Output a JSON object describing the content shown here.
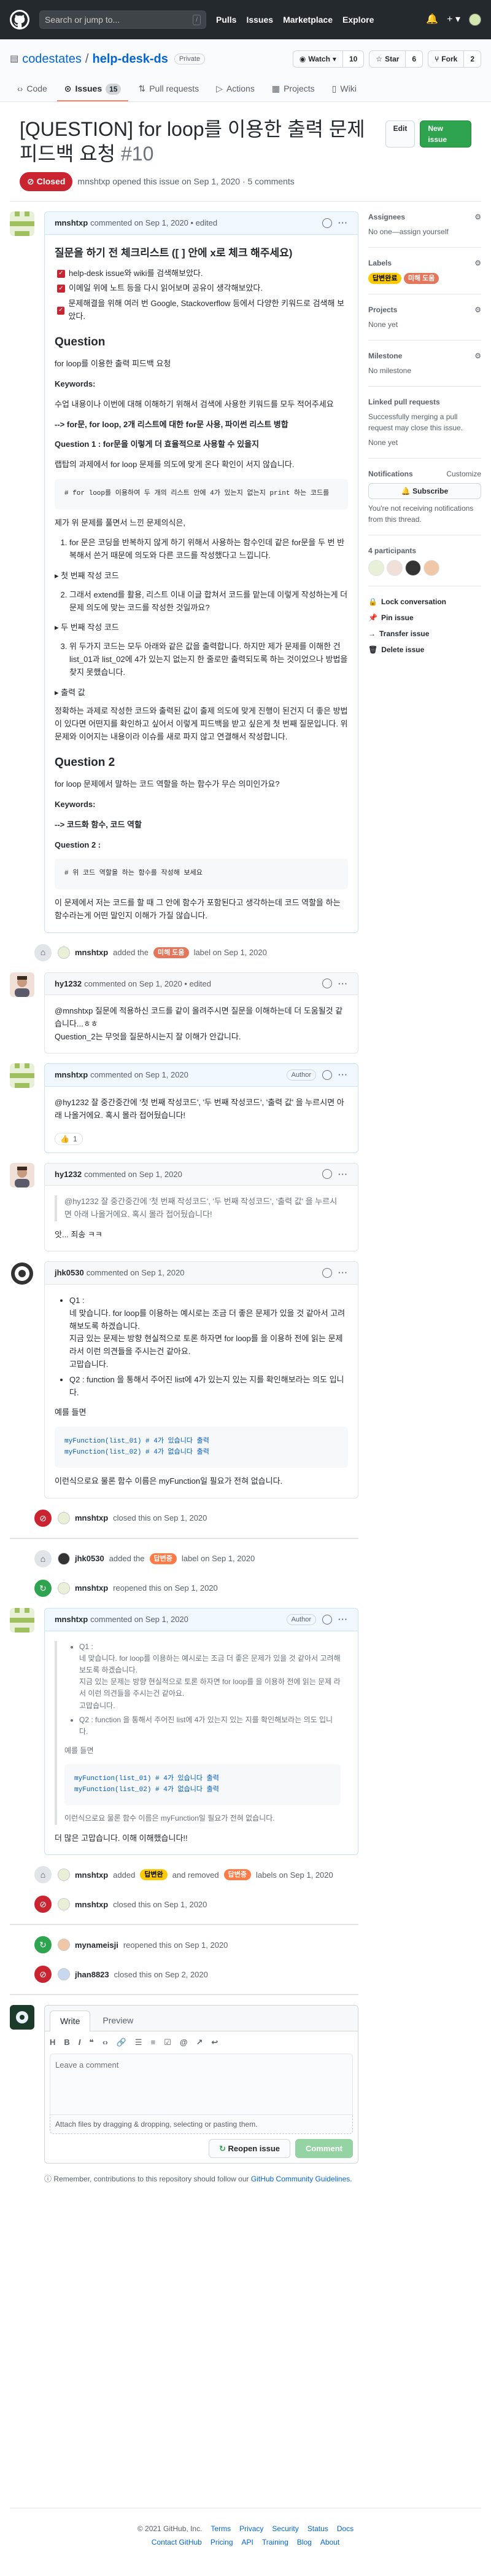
{
  "header": {
    "search_placeholder": "Search or jump to...",
    "search_shortcut": "/",
    "nav": [
      "Pulls",
      "Issues",
      "Marketplace",
      "Explore"
    ]
  },
  "repo": {
    "owner": "codestates",
    "name": "help-desk-ds",
    "visibility": "Private",
    "watch_label": "Watch",
    "watch_count": "10",
    "star_label": "Star",
    "star_count": "6",
    "fork_label": "Fork",
    "fork_count": "2",
    "tabs": [
      {
        "label": "Code"
      },
      {
        "label": "Issues",
        "count": "15"
      },
      {
        "label": "Pull requests"
      },
      {
        "label": "Actions"
      },
      {
        "label": "Projects"
      },
      {
        "label": "Wiki"
      }
    ]
  },
  "issue": {
    "title": "[QUESTION] for loop를 이용한 출력 문제 피드백 요청",
    "number": "#10",
    "edit_label": "Edit",
    "new_issue_label": "New issue",
    "state": "Closed",
    "meta": "mnshtxp opened this issue on Sep 1, 2020 · 5 comments"
  },
  "comments": {
    "c1": {
      "author": "mnshtxp",
      "meta": "commented on Sep 1, 2020 • edited",
      "h_check": "질문을 하기 전 체크리스트 ([ ] 안에 x로 체크 해주세요)",
      "checks": [
        "help-desk issue와 wiki를 검색해보았다.",
        "이메일 위에 노트 등을 다시 읽어보며 공유이 생각해보았다.",
        "문제해결을 위해 여러 번 Google, Stackoverflow 등에서 다양한 키워드로 검색해 보았다."
      ],
      "h_q1": "Question",
      "q1_text": "for loop를 이용한 출력 피드백 요청",
      "kw_label": "Keywords:",
      "kw1": "수업 내용이나 이번에 대해 이해하기 위해서 검색에 사용한 키워드를 모두 적어주세요",
      "kw2": "--> for문, for loop, 2개 리스트에 대한 for문 사용, 파이썬 리스트 병합",
      "q1_label": "Question 1 : for문을 이렇게 더 효율적으로 사용할 수 있을지",
      "q1_desc": "랩탑의 과제에서 for loop 문제를 의도에 맞게 온다 확인이 서지 않습니다.",
      "code1": "# for loop를 이용하여 두 개의 리스트 안에 4가 있는지 없는지 print 하는 코드를",
      "q1_desc2": "제가 위 문제를 풀면서 느낀 문제의식은,",
      "ol": [
        "for 문은 코딩을 반복하지 않게 하기 위해서 사용하는 함수인데 같은 for문을 두 번 반복해서 쓴거 때문에 의도와 다른 코드를 작성했다고 느낍니다.",
        "그래서 extend를 활용, 리스트 이내 이글 합쳐서 코드를 맡는데 이렇게 작성하는게 더 문제 의도에 맞는 코드를 작성한 것일까요?",
        "위 두가지 코드는 모두 아래와 같은 값을 출력합니다. 하지만 제가 문제를 이해한 건 list_01과 list_02에 4가 있는지 없는지 한 줄로만 출력되도록 하는 것이었으나 방법을 찾지 못했습니다."
      ],
      "sum1": "▸ 첫 번째 작성 코드",
      "sum2": "▸ 두 번째 작성 코드",
      "sum3": "▸ 출력 값",
      "q1_end": "정확하는 과제로 작성한 코드와 출력된 값이 출제 의도에 맞게 진행이 된건지 더 좋은 방법이 있다면 어떤지를 확인하고 싶어서 이렇게 피드백을 받고 싶은게 첫 번째 질문입니다. 위 문제와 이어지는 내용이라 이슈를 새로 파지 않고 연결해서 작성합니다.",
      "h_q2": "Question 2",
      "q2_text": "for loop 문제에서 말하는 코드 역할을 하는 함수가 무슨 의미인가요?",
      "kw3": "--> 코드화 함수, 코드 역할",
      "q2_label": "Question 2 :",
      "code2": "# 위 코드 역할을 하는 함수를 작성해 보세요",
      "q2_end": "이 문제에서 저는 코드를 할 때 그 안에 함수가 포함된다고 생각하는데 코드 역할을 하는 함수라는게 어떤 말인지 이해가 가질 않습니다."
    },
    "c2": {
      "author": "hy1232",
      "meta": "commented on Sep 1, 2020 • edited",
      "p1": "@mnshtxp 질문에 적용하신 코드를 같이 올려주시면 질문을 이해하는데 더 도움될것 같습니다...ㅎㅎ",
      "p2": "Question_2는 무엇을 질문하시는지 잘 이해가 안갑니다."
    },
    "c3": {
      "author": "mnshtxp",
      "meta": "commented on Sep 1, 2020",
      "role": "Author",
      "p1": "@hy1232 잘 중간중간에 '첫 번째 작성코드', '두 번째 작성코드', '출력 값' 을 누르시면 아래 나올거에요. 혹시 몰라 접어뒀습니다!",
      "reaction": "1"
    },
    "c4": {
      "author": "hy1232",
      "meta": "commented on Sep 1, 2020",
      "quote": "@hy1232 잘 중간중간에 '첫 번째 작성코드', '두 번째 작성코드', '출력 값' 을 누르시면 아래 나올거에요. 혹시 몰라 접어뒀습니다!",
      "p1": "앗... 죄송 ㅋㅋ"
    },
    "c5": {
      "author": "jhk0530",
      "meta": "commented on Sep 1, 2020",
      "q1": "Q1 :",
      "q1a": "네 맞습니다. for loop를 이용하는 예시로는 조금 더 좋은 문제가 있을 것 같아서 고려해보도록 하겠습니다.",
      "q1b": "지금 있는 문제는 방향 현실적으로 토론 하자면 for loop를 을 이용하 전에 읽는 문제 라서 이런 의견들을 주시는건 같아요.",
      "q1c": "고맙습니다.",
      "q2": "Q2 : function 을 통해서 주어진 list에 4가 있는지 있는 지를 확인해보라는 의도 입니다.",
      "ex_label": "예를 들면",
      "code": "myFunction(list_01) # 4가 있습니다 출력\nmyFunction(list_02) # 4가 없습니다 출력",
      "end": "이런식으로요 물론 함수 이름은 myFunction일 필요가 전혀 없습니다."
    },
    "c6": {
      "author": "mnshtxp",
      "meta": "commented on Sep 1, 2020",
      "role": "Author",
      "end": "더 많은 고맙습니다. 이해 이해했습니다!!"
    }
  },
  "events": {
    "e1": {
      "actor": "mnshtxp",
      "pre": "added the",
      "label": "미해 도움",
      "post": "label on Sep 1, 2020"
    },
    "e2": {
      "actor": "mnshtxp",
      "text": "closed this on Sep 1, 2020"
    },
    "e3": {
      "actor": "jhk0530",
      "pre": "added the",
      "label": "답변중",
      "post": "label on Sep 1, 2020"
    },
    "e4": {
      "actor": "mnshtxp",
      "text": "reopened this on Sep 1, 2020"
    },
    "e5": {
      "actor": "mnshtxp",
      "pre": "added",
      "label": "답변완",
      "mid": "and removed",
      "label2": "답변중",
      "post": "labels on Sep 1, 2020"
    },
    "e6": {
      "actor": "mnshtxp",
      "text": "closed this on Sep 1, 2020"
    },
    "e7": {
      "actor": "mynameisji",
      "text": "reopened this on Sep 1, 2020"
    },
    "e8": {
      "actor": "jhan8823",
      "text": "closed this on Sep 2, 2020"
    }
  },
  "composer": {
    "tab_write": "Write",
    "tab_preview": "Preview",
    "placeholder": "Leave a comment",
    "attach": "Attach files by dragging & dropping, selecting or pasting them.",
    "reopen": "Reopen issue",
    "comment": "Comment",
    "note": "Remember, contributions to this repository should follow our",
    "note_link": "GitHub Community Guidelines."
  },
  "sidebar": {
    "assignees_title": "Assignees",
    "assignees_text": "No one—assign yourself",
    "labels_title": "Labels",
    "labels": [
      "답변완료",
      "미해 도움"
    ],
    "projects_title": "Projects",
    "projects_text": "None yet",
    "milestone_title": "Milestone",
    "milestone_text": "No milestone",
    "linked_title": "Linked pull requests",
    "linked_text": "Successfully merging a pull request may close this issue.",
    "linked_none": "None yet",
    "notif_title": "Notifications",
    "notif_customize": "Customize",
    "subscribe": "Subscribe",
    "notif_text": "You're not receiving notifications from this thread.",
    "participants": "4 participants",
    "lock": "Lock conversation",
    "pin": "Pin issue",
    "transfer": "Transfer issue",
    "delete": "Delete issue"
  },
  "footer": {
    "copy": "© 2021 GitHub, Inc.",
    "row1": [
      "Terms",
      "Privacy",
      "Security",
      "Status",
      "Docs"
    ],
    "row2": [
      "Contact GitHub",
      "Pricing",
      "API",
      "Training",
      "Blog",
      "About"
    ]
  }
}
